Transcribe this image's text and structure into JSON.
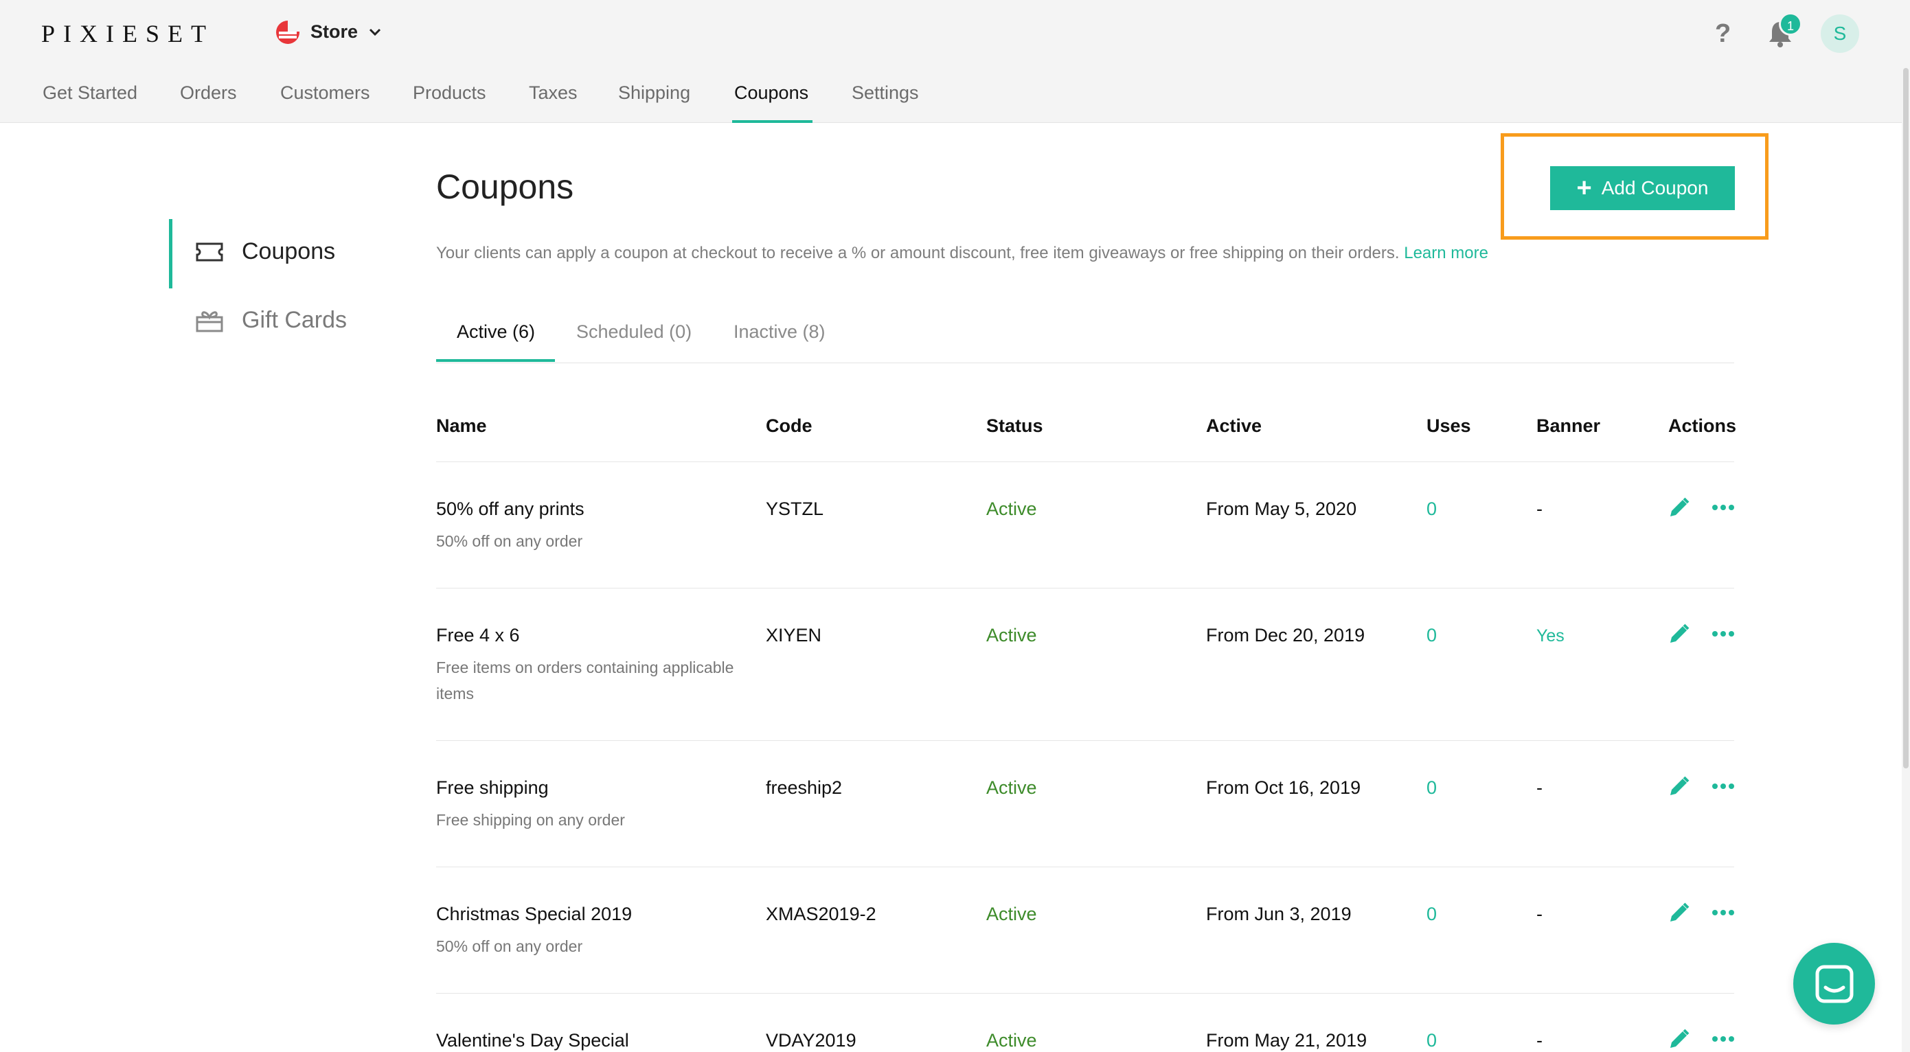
{
  "brand": {
    "logo": "PIXIESET"
  },
  "store": {
    "label": "Store"
  },
  "topbar": {
    "help_label": "?",
    "notification_count": "1",
    "avatar_initial": "S"
  },
  "nav": {
    "items": [
      "Get Started",
      "Orders",
      "Customers",
      "Products",
      "Taxes",
      "Shipping",
      "Coupons",
      "Settings"
    ],
    "active": "Coupons"
  },
  "sidebar": {
    "items": [
      {
        "label": "Coupons",
        "icon": "ticket-icon",
        "active": true
      },
      {
        "label": "Gift Cards",
        "icon": "gift-icon",
        "active": false
      }
    ]
  },
  "main": {
    "title": "Coupons",
    "description": "Your clients can apply a coupon at checkout to receive a % or amount discount, free item giveaways or free shipping on their orders.",
    "learn_more": "Learn more",
    "add_button": "Add Coupon",
    "tabs": [
      {
        "label": "Active (6)",
        "active": true
      },
      {
        "label": "Scheduled (0)",
        "active": false
      },
      {
        "label": "Inactive (8)",
        "active": false
      }
    ],
    "columns": [
      "Name",
      "Code",
      "Status",
      "Active",
      "Uses",
      "Banner",
      "Actions"
    ],
    "rows": [
      {
        "name": "50% off any prints",
        "sub": "50% off on any order",
        "code": "YSTZL",
        "status": "Active",
        "active": "From May 5, 2020",
        "uses": "0",
        "banner": "-"
      },
      {
        "name": "Free 4 x 6",
        "sub": "Free items on orders containing applicable items",
        "code": "XIYEN",
        "status": "Active",
        "active": "From Dec 20, 2019",
        "uses": "0",
        "banner": "Yes"
      },
      {
        "name": "Free shipping",
        "sub": "Free shipping on any order",
        "code": "freeship2",
        "status": "Active",
        "active": "From Oct 16, 2019",
        "uses": "0",
        "banner": "-"
      },
      {
        "name": "Christmas Special 2019",
        "sub": "50% off on any order",
        "code": "XMAS2019-2",
        "status": "Active",
        "active": "From Jun 3, 2019",
        "uses": "0",
        "banner": "-"
      },
      {
        "name": "Valentine's Day Special",
        "sub": "",
        "code": "VDAY2019",
        "status": "Active",
        "active": "From May 21, 2019",
        "uses": "0",
        "banner": "-"
      }
    ]
  },
  "colors": {
    "accent": "#1fb99a",
    "status_active": "#3d8b2a",
    "highlight": "#f89c1c"
  }
}
